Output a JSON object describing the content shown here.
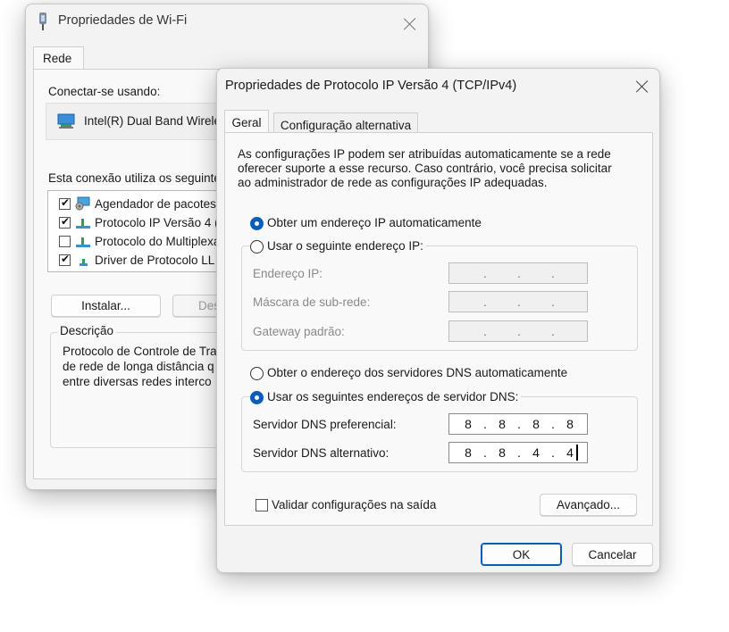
{
  "wifi_window": {
    "title": "Propriedades de Wi-Fi",
    "tab": "Rede",
    "connect_using_label": "Conectar-se usando:",
    "adapter_name": "Intel(R) Dual Band Wirele",
    "connection_uses_label": "Esta conexão utiliza os seguinte",
    "items": [
      {
        "label": "Agendador de pacotes",
        "checked": true,
        "icon": "qos-icon"
      },
      {
        "label": "Protocolo IP Versão 4 (",
        "checked": true,
        "icon": "protocol-icon"
      },
      {
        "label": "Protocolo do Multiplexa",
        "checked": false,
        "icon": "protocol-icon"
      },
      {
        "label": "Driver de Protocolo LL",
        "checked": true,
        "icon": "protocol-icon"
      }
    ],
    "install_button": "Instalar...",
    "uninstall_button": "Des",
    "description_legend": "Descrição",
    "description_lines": [
      "Protocolo de Controle de Tra",
      "de rede de longa distância q",
      "entre diversas redes interco"
    ]
  },
  "ipv4_dialog": {
    "title": "Propriedades de Protocolo IP Versão 4 (TCP/IPv4)",
    "tabs": {
      "general": "Geral",
      "alternate": "Configuração alternativa"
    },
    "description_lines": [
      "As configurações IP podem ser atribuídas automaticamente se a rede",
      "oferecer suporte a esse recurso. Caso contrário, você precisa solicitar",
      "ao administrador de rede as configurações IP adequadas."
    ],
    "ip_auto_radio": {
      "label": "Obter um endereço IP automaticamente",
      "selected": true
    },
    "ip_manual_radio": {
      "label": "Usar o seguinte endereço IP:",
      "selected": false
    },
    "ip_address_label": "Endereço IP:",
    "subnet_label": "Máscara de sub-rede:",
    "gateway_label": "Gateway padrão:",
    "empty_ip": {
      "dot": "."
    },
    "dns_auto_radio": {
      "label": "Obter o endereço dos servidores DNS automaticamente",
      "selected": false
    },
    "dns_manual_radio": {
      "label": "Usar os seguintes endereços de servidor DNS:",
      "selected": true
    },
    "preferred_dns_label": "Servidor DNS preferencial:",
    "preferred_dns": {
      "o1": "8",
      "o2": "8",
      "o3": "8",
      "o4": "8"
    },
    "alternate_dns_label": "Servidor DNS alternativo:",
    "alternate_dns": {
      "o1": "8",
      "o2": "8",
      "o3": "4",
      "o4": "4"
    },
    "validate_checkbox": {
      "label": "Validar configurações na saída",
      "checked": false
    },
    "advanced_button": "Avançado...",
    "ok_button": "OK",
    "cancel_button": "Cancelar"
  },
  "colors": {
    "accent": "#0a5cb8",
    "window_bg": "#f3f3f3",
    "pane_bg": "#f9f9f9"
  }
}
